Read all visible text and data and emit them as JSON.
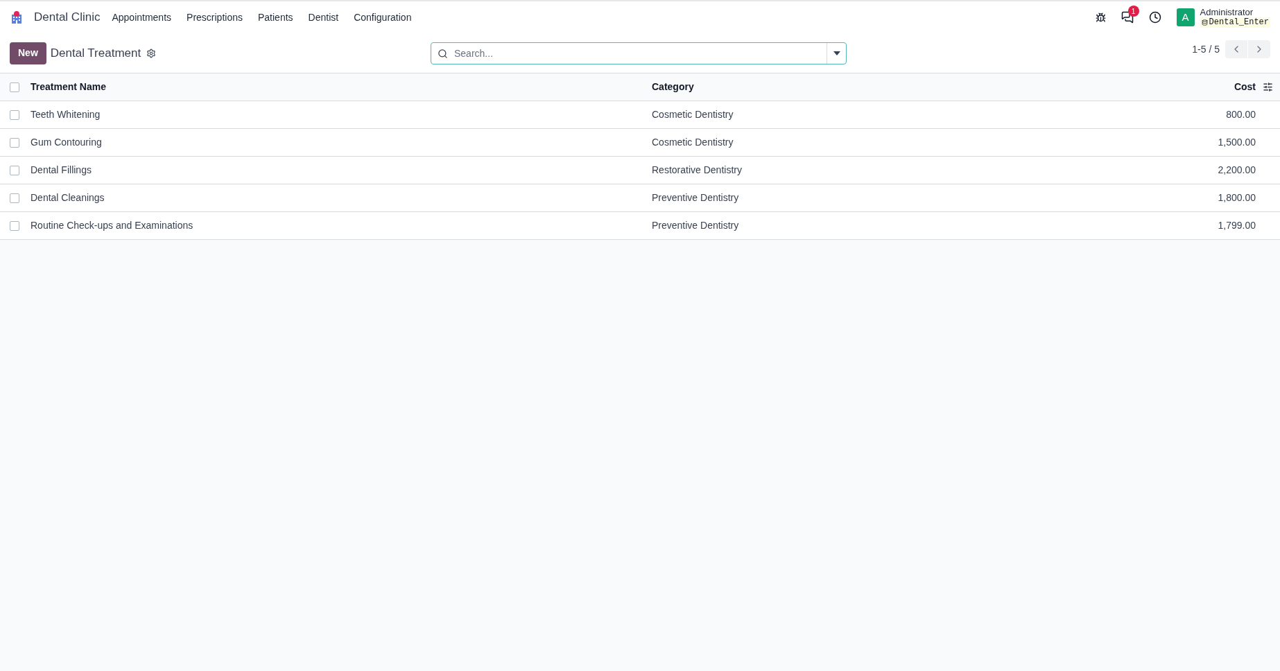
{
  "navbar": {
    "app_name": "Dental Clinic",
    "menu": [
      "Appointments",
      "Prescriptions",
      "Patients",
      "Dentist",
      "Configuration"
    ],
    "messages_badge": "1",
    "user": {
      "avatar_letter": "A",
      "name": "Administrator",
      "database": "Dental_Enter"
    }
  },
  "control_panel": {
    "new_button": "New",
    "title": "Dental Treatment",
    "search": {
      "placeholder": "Search..."
    },
    "pager": "1-5 / 5"
  },
  "table": {
    "columns": [
      "Treatment Name",
      "Category",
      "Cost"
    ],
    "all_checked": false,
    "rows": [
      {
        "name": "Teeth Whitening",
        "category": "Cosmetic Dentistry",
        "cost": "800.00",
        "checked": false
      },
      {
        "name": "Gum Contouring",
        "category": "Cosmetic Dentistry",
        "cost": "1,500.00",
        "checked": false
      },
      {
        "name": "Dental Fillings",
        "category": "Restorative Dentistry",
        "cost": "2,200.00",
        "checked": false
      },
      {
        "name": "Dental Cleanings",
        "category": "Preventive Dentistry",
        "cost": "1,800.00",
        "checked": false
      },
      {
        "name": "Routine Check-ups and Examinations",
        "category": "Preventive Dentistry",
        "cost": "1,799.00",
        "checked": false
      }
    ]
  }
}
